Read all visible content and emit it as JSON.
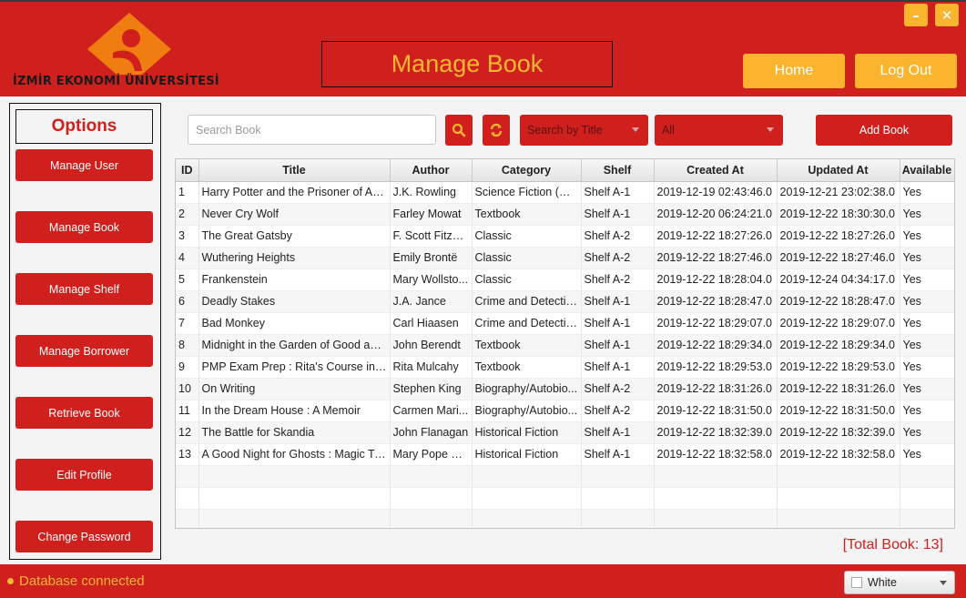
{
  "header": {
    "logo_text": "İZMİR EKONOMİ ÜNİVERSİTESİ",
    "page_title": "Manage Book",
    "minimize_icon": "minimize-icon",
    "close_icon": "close-icon",
    "home_label": "Home",
    "logout_label": "Log Out"
  },
  "sidebar": {
    "title": "Options",
    "items": [
      {
        "label": "Manage User"
      },
      {
        "label": "Manage Book"
      },
      {
        "label": "Manage Shelf"
      },
      {
        "label": "Manage Borrower"
      },
      {
        "label": "Retrieve Book"
      },
      {
        "label": "Edit Profile"
      },
      {
        "label": "Change Password"
      }
    ]
  },
  "toolbar": {
    "search_placeholder": "Search Book",
    "search_value": "",
    "search_icon": "search-icon",
    "refresh_icon": "refresh-icon",
    "search_by_selected": "Search by Title",
    "category_selected": "All",
    "add_label": "Add Book"
  },
  "table": {
    "columns": [
      "ID",
      "Title",
      "Author",
      "Category",
      "Shelf",
      "Created At",
      "Updated At",
      "Available"
    ],
    "rows": [
      [
        "1",
        "Harry Potter and the Prisoner of Azk...",
        "J.K. Rowling",
        "Science Fiction (Sci...",
        "Shelf A-1",
        "2019-12-19 02:43:46.0",
        "2019-12-21 23:02:38.0",
        "Yes"
      ],
      [
        "2",
        "Never Cry Wolf",
        "Farley Mowat",
        "Textbook",
        "Shelf A-1",
        "2019-12-20 06:24:21.0",
        "2019-12-22 18:30:30.0",
        "Yes"
      ],
      [
        "3",
        "The Great Gatsby",
        "F. Scott Fitzge...",
        "Classic",
        "Shelf A-2",
        "2019-12-22 18:27:26.0",
        "2019-12-22 18:27:26.0",
        "Yes"
      ],
      [
        "4",
        "Wuthering Heights",
        "Emily Brontë",
        "Classic",
        "Shelf A-2",
        "2019-12-22 18:27:46.0",
        "2019-12-22 18:27:46.0",
        "Yes"
      ],
      [
        "5",
        "Frankenstein",
        "Mary Wollsto...",
        "Classic",
        "Shelf A-2",
        "2019-12-22 18:28:04.0",
        "2019-12-24 04:34:17.0",
        "Yes"
      ],
      [
        "6",
        "Deadly Stakes",
        "J.A. Jance",
        "Crime and Detective",
        "Shelf A-1",
        "2019-12-22 18:28:47.0",
        "2019-12-22 18:28:47.0",
        "Yes"
      ],
      [
        "7",
        "Bad Monkey",
        "Carl Hiaasen",
        "Crime and Detective",
        "Shelf A-1",
        "2019-12-22 18:29:07.0",
        "2019-12-22 18:29:07.0",
        "Yes"
      ],
      [
        "8",
        "Midnight in the Garden of Good and...",
        "John Berendt",
        "Textbook",
        "Shelf A-1",
        "2019-12-22 18:29:34.0",
        "2019-12-22 18:29:34.0",
        "Yes"
      ],
      [
        "9",
        "PMP Exam Prep : Rita's Course in a B...",
        "Rita Mulcahy",
        "Textbook",
        "Shelf A-1",
        "2019-12-22 18:29:53.0",
        "2019-12-22 18:29:53.0",
        "Yes"
      ],
      [
        "10",
        "On Writing",
        "Stephen King",
        "Biography/Autobio...",
        "Shelf A-2",
        "2019-12-22 18:31:26.0",
        "2019-12-22 18:31:26.0",
        "Yes"
      ],
      [
        "11",
        "In the Dream House : A Memoir",
        "Carmen Mari...",
        "Biography/Autobio...",
        "Shelf A-2",
        "2019-12-22 18:31:50.0",
        "2019-12-22 18:31:50.0",
        "Yes"
      ],
      [
        "12",
        "The Battle for Skandia",
        "John Flanagan",
        "Historical Fiction",
        "Shelf A-1",
        "2019-12-22 18:32:39.0",
        "2019-12-22 18:32:39.0",
        "Yes"
      ],
      [
        "13",
        "A Good Night for Ghosts : Magic Tre...",
        "Mary Pope O...",
        "Historical Fiction",
        "Shelf A-1",
        "2019-12-22 18:32:58.0",
        "2019-12-22 18:32:58.0",
        "Yes"
      ]
    ],
    "empty_rows": 3
  },
  "total_label": "[Total Book: 13]",
  "footer": {
    "status_text": "Database connected",
    "theme_selected": "White"
  },
  "colors": {
    "primary_red": "#cf201e",
    "accent_yellow": "#fbb42d",
    "title_yellow": "#f9b731",
    "logo_orange": "#ef7d12"
  }
}
